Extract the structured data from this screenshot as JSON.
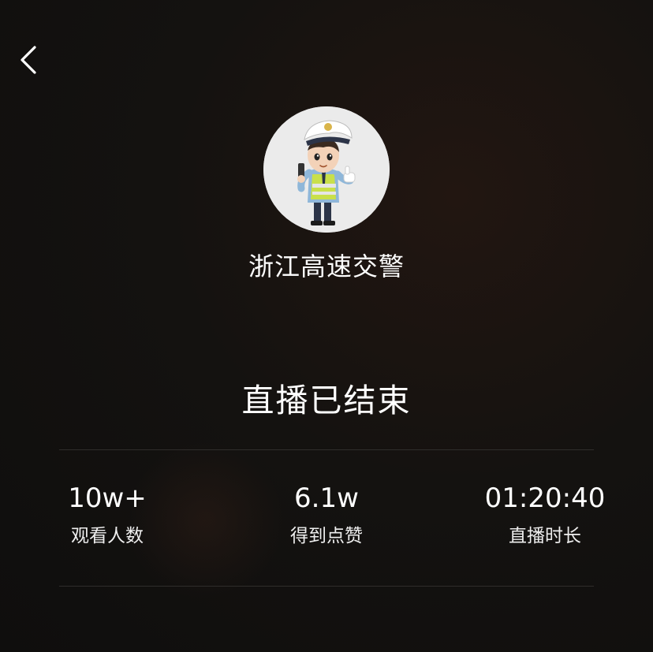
{
  "nav": {
    "back_icon": "chevron-left-icon"
  },
  "profile": {
    "avatar_icon": "police-officer-avatar",
    "name": "浙江高速交警"
  },
  "status": {
    "title": "直播已结束"
  },
  "stats": [
    {
      "value": "10w+",
      "label": "观看人数"
    },
    {
      "value": "6.1w",
      "label": "得到点赞"
    },
    {
      "value": "01:20:40",
      "label": "直播时长"
    }
  ],
  "colors": {
    "background": "#121110",
    "text": "#ffffff",
    "divider": "#2f2d2b"
  }
}
